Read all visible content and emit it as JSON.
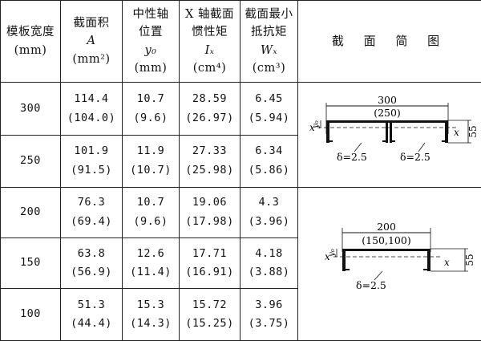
{
  "header": {
    "width": {
      "line1": "模板宽度",
      "line2": "(mm)"
    },
    "area": {
      "line1": "截面积",
      "line2": "A",
      "line3": "(mm²)"
    },
    "neutral_axis": {
      "line1": "中性轴",
      "line2": "位置",
      "line3": "y₀",
      "line4": "(mm)"
    },
    "inertia": {
      "line1": "X 轴截面",
      "line2": "惯性矩",
      "line3": "Iₓ",
      "line4": "(cm⁴)"
    },
    "modulus": {
      "line1": "截面最小",
      "line2": "抵抗矩",
      "line3": "Wₓ",
      "line4": "(cm³)"
    },
    "figure": "截 面 简 图"
  },
  "rows": [
    {
      "width": "300",
      "area": "114.4",
      "area_p": "(104.0)",
      "y0": "10.7",
      "y0_p": "(9.6)",
      "ix": "28.59",
      "ix_p": "(26.97)",
      "wx": "6.45",
      "wx_p": "(5.94)"
    },
    {
      "width": "250",
      "area": "101.9",
      "area_p": "(91.5)",
      "y0": "11.9",
      "y0_p": "(10.7)",
      "ix": "27.33",
      "ix_p": "(25.98)",
      "wx": "6.34",
      "wx_p": "(5.86)"
    },
    {
      "width": "200",
      "area": "76.3",
      "area_p": "(69.4)",
      "y0": "10.7",
      "y0_p": "(9.6)",
      "ix": "19.06",
      "ix_p": "(17.98)",
      "wx": "4.3",
      "wx_p": "(3.96)"
    },
    {
      "width": "150",
      "area": "63.8",
      "area_p": "(56.9)",
      "y0": "12.6",
      "y0_p": "(11.4)",
      "ix": "17.71",
      "ix_p": "(16.91)",
      "wx": "4.18",
      "wx_p": "(3.88)"
    },
    {
      "width": "100",
      "area": "51.3",
      "area_p": "(44.4)",
      "y0": "15.3",
      "y0_p": "(14.3)",
      "ix": "15.72",
      "ix_p": "(15.25)",
      "wx": "3.96",
      "wx_p": "(3.75)"
    }
  ],
  "diagram_top": {
    "dim_outer": "300",
    "dim_inner": "(250)",
    "axis_left": "x",
    "axis_right": "x",
    "y0_label": "y₀",
    "height": "55",
    "thick_left": "δ=2.5",
    "thick_right": "δ=2.5"
  },
  "diagram_bottom": {
    "dim_outer": "200",
    "dim_inner": "(150,100)",
    "axis_left": "x",
    "axis_right": "x",
    "y0_label": "y₀",
    "height": "55",
    "thick": "δ=2.5"
  }
}
